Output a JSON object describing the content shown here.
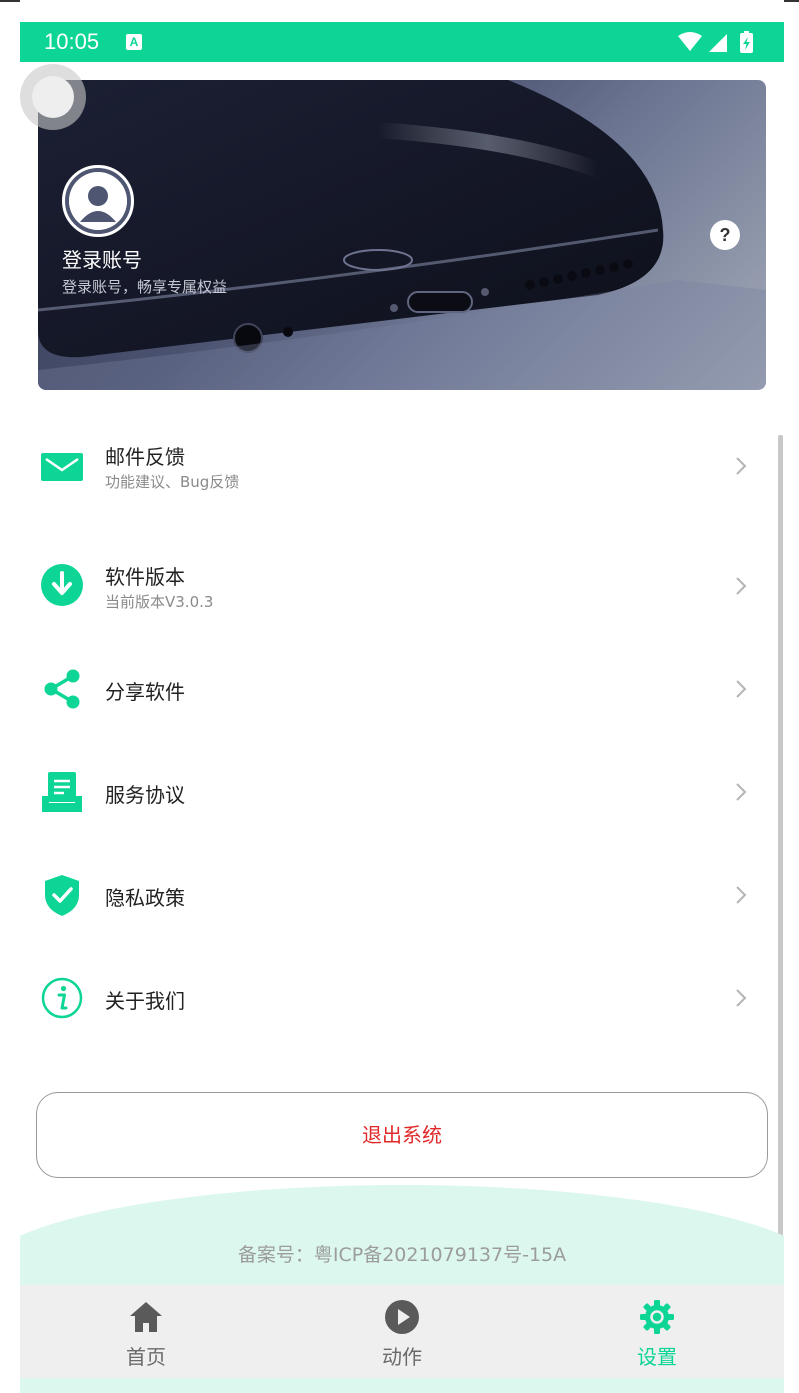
{
  "status_bar": {
    "time": "10:05",
    "indicator": "A",
    "icons": [
      "wifi-icon",
      "signal-icon",
      "battery-charging-icon"
    ]
  },
  "colors": {
    "accent": "#0cd596",
    "logout_text": "#e02a2a",
    "footer_bg": "#dcf7ee"
  },
  "banner": {
    "avatar_icon": "user-avatar-icon",
    "login_title": "登录账号",
    "login_subtitle": "登录账号，畅享专属权益",
    "help_label": "?"
  },
  "menu": {
    "items": [
      {
        "icon": "mail-icon",
        "title": "邮件反馈",
        "subtitle": "功能建议、Bug反馈"
      },
      {
        "icon": "download-icon",
        "title": "软件版本",
        "subtitle": "当前版本V3.0.3"
      },
      {
        "icon": "share-icon",
        "title": "分享软件",
        "subtitle": ""
      },
      {
        "icon": "agreement-icon",
        "title": "服务协议",
        "subtitle": ""
      },
      {
        "icon": "shield-check-icon",
        "title": "隐私政策",
        "subtitle": ""
      },
      {
        "icon": "info-icon",
        "title": "关于我们",
        "subtitle": ""
      }
    ]
  },
  "logout_label": "退出系统",
  "icp_text": "备案号：粤ICP备2021079137号-15A",
  "bottom_nav": {
    "tabs": [
      {
        "icon": "home-icon",
        "label": "首页",
        "active": false
      },
      {
        "icon": "play-icon",
        "label": "动作",
        "active": false
      },
      {
        "icon": "settings-gear-icon",
        "label": "设置",
        "active": true
      }
    ]
  }
}
